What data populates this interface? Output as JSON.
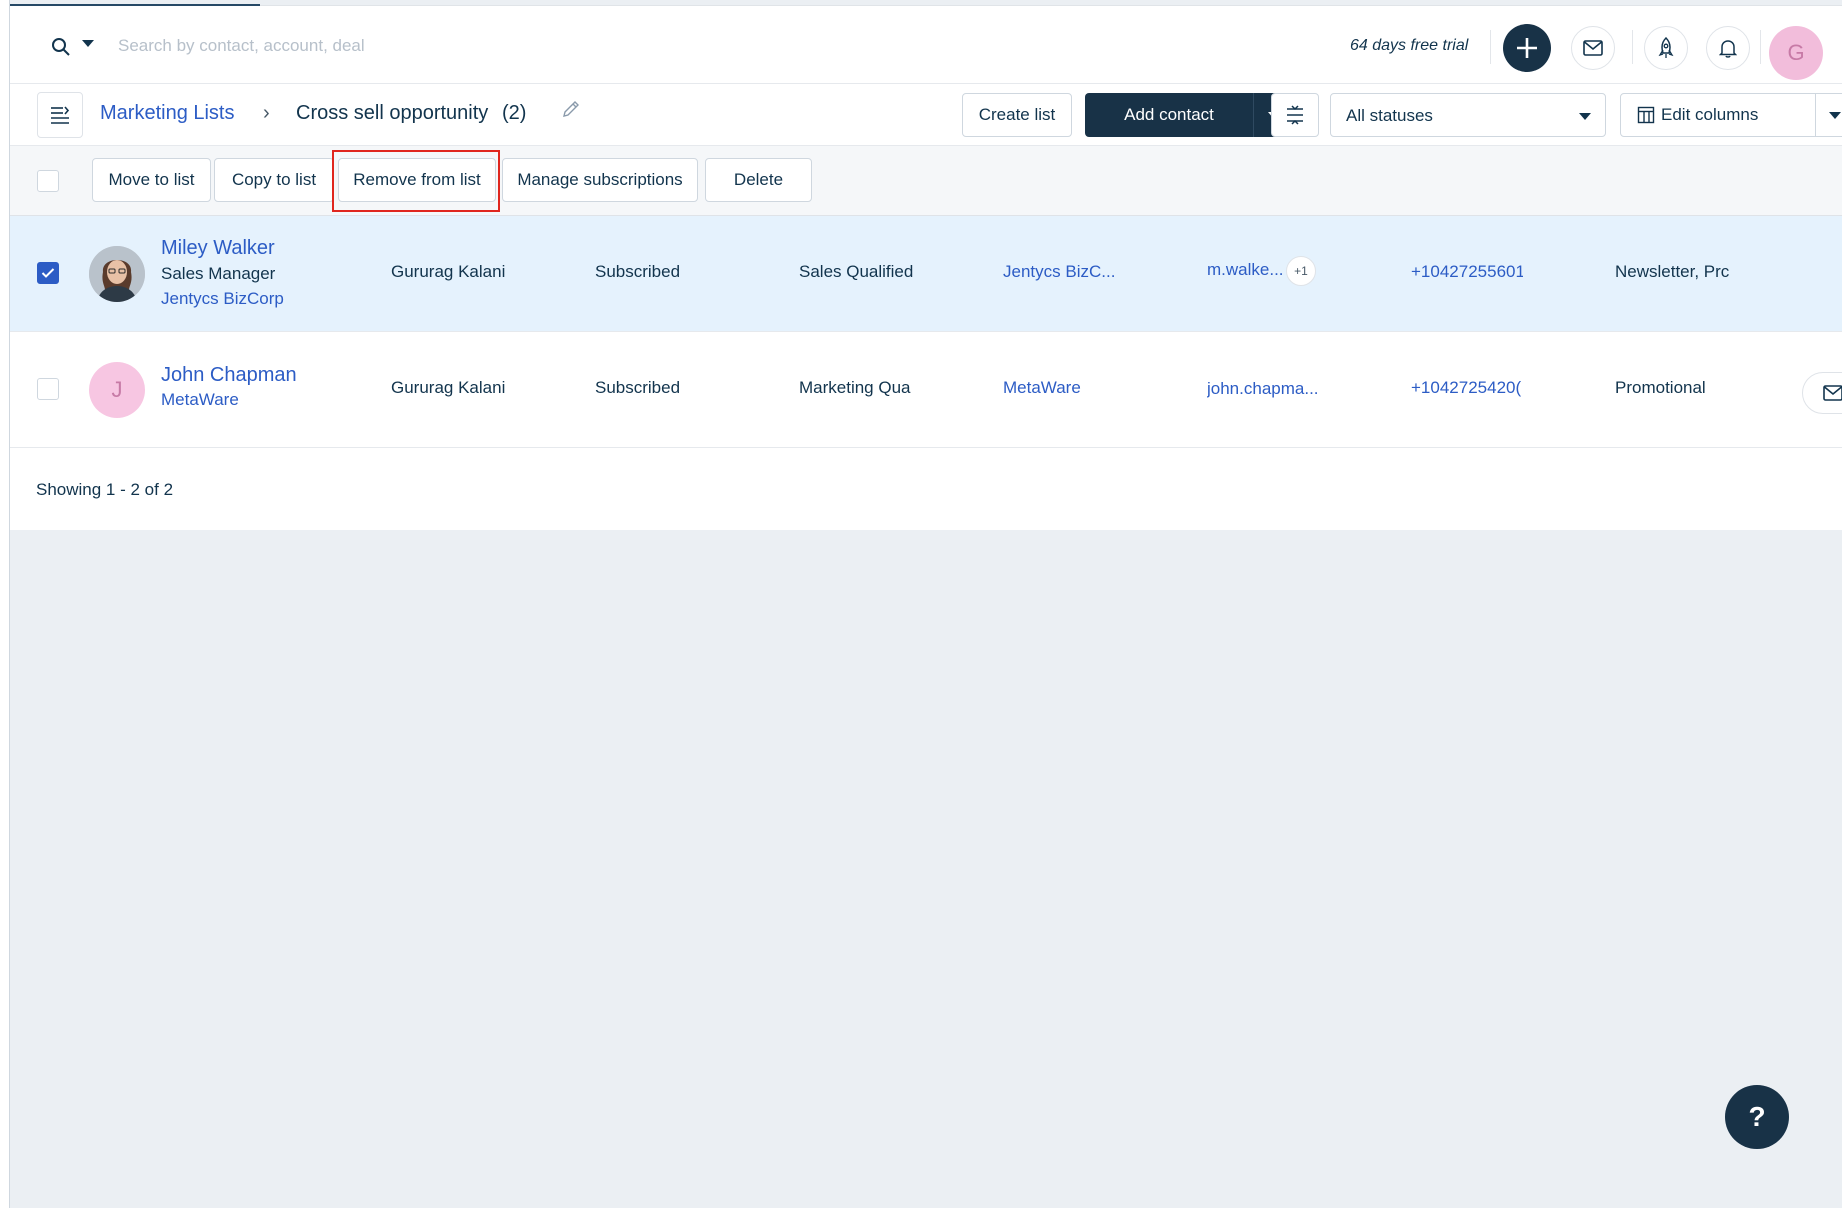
{
  "topbar": {
    "search_placeholder": "Search by contact, account, deal",
    "trial_text": "64 days free trial",
    "user_initial": "G"
  },
  "header": {
    "breadcrumb_parent": "Marketing Lists",
    "breadcrumb_separator": "›",
    "list_name": "Cross sell opportunity",
    "list_count": "(2)",
    "create_list": "Create list",
    "add_contact": "Add contact",
    "status_filter": "All statuses",
    "edit_columns": "Edit columns"
  },
  "bulk_actions": {
    "move": "Move to list",
    "copy": "Copy to list",
    "remove": "Remove from list",
    "subscriptions": "Manage subscriptions",
    "delete": "Delete"
  },
  "rows": [
    {
      "checked": true,
      "name": "Miley Walker",
      "title": "Sales Manager",
      "account": "Jentycs BizCorp",
      "owner": "Gururag Kalani",
      "subscription": "Subscribed",
      "lifecycle": "Sales Qualified",
      "account_col": "Jentycs BizC...",
      "email": "m.walke...",
      "email_more": "+1",
      "phone": "+10427255601",
      "lists": "Newsletter, Prc"
    },
    {
      "checked": false,
      "initial": "J",
      "name": "John Chapman",
      "account": "MetaWare",
      "owner": "Gururag Kalani",
      "subscription": "Subscribed",
      "lifecycle": "Marketing Qual",
      "account_col": "MetaWare",
      "email": "john.chapma...",
      "phone": "+1042725420(",
      "lists": "Promotional"
    }
  ],
  "footer": {
    "showing": "Showing 1 - 2 of 2"
  },
  "help": {
    "label": "?"
  },
  "colors": {
    "primary_dark": "#183247",
    "link_blue": "#2c5cc5",
    "selected_row": "#e5f2fd",
    "highlight_red": "#e0261e",
    "avatar_pink": "#f2bddb"
  }
}
